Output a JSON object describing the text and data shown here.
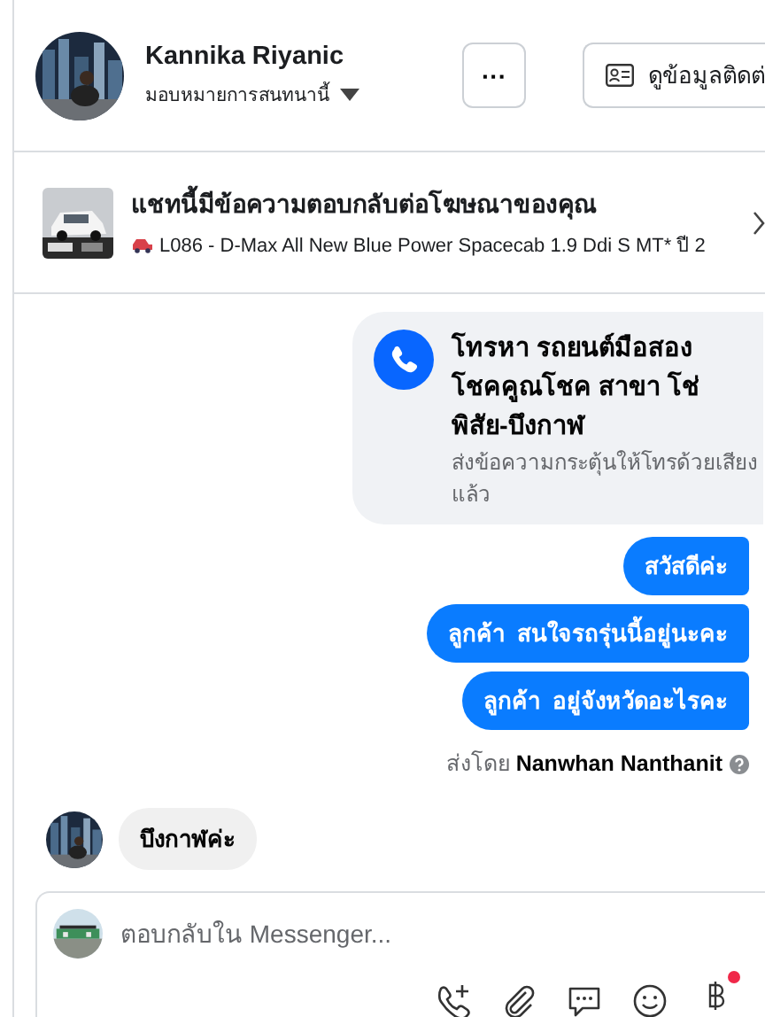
{
  "header": {
    "name": "Kannika Riyanic",
    "assign_label": "มอบหมายการสนทนานี้",
    "more_button": "···",
    "contact_button": "ดูข้อมูลติดต่"
  },
  "ad_reply": {
    "title": "แชทนี้มีข้อความตอบกลับต่อโฆษณาของคุณ",
    "subtitle": "L086 - D-Max All New Blue Power Spacecab 1.9 Ddi S MT* ปี 2"
  },
  "call_card": {
    "title": "โทรหา รถยนต์มือสอง โชคคูณโชค สาขา โช่พิสัย-บึงกาฬ",
    "subtitle": "ส่งข้อความกระตุ้นให้โทรด้วยเสียงแล้ว"
  },
  "messages": [
    {
      "text": "สวัสดีค่ะ",
      "outgoing": true
    },
    {
      "text": "ลูกค้า  สนใจรถรุ่นนี้อยู่นะคะ",
      "outgoing": true
    },
    {
      "text": "ลูกค้า  อยู่จังหวัดอะไรคะ",
      "outgoing": true
    },
    {
      "text": "ส่งโดย **Nanwhan Nanthanit**",
      "kind": "sent_by"
    },
    {
      "text": "บึงกาฬค่ะ",
      "outgoing": false
    }
  ],
  "composer": {
    "placeholder": "ตอบกลับใน Messenger...",
    "payment_notification": true
  }
}
